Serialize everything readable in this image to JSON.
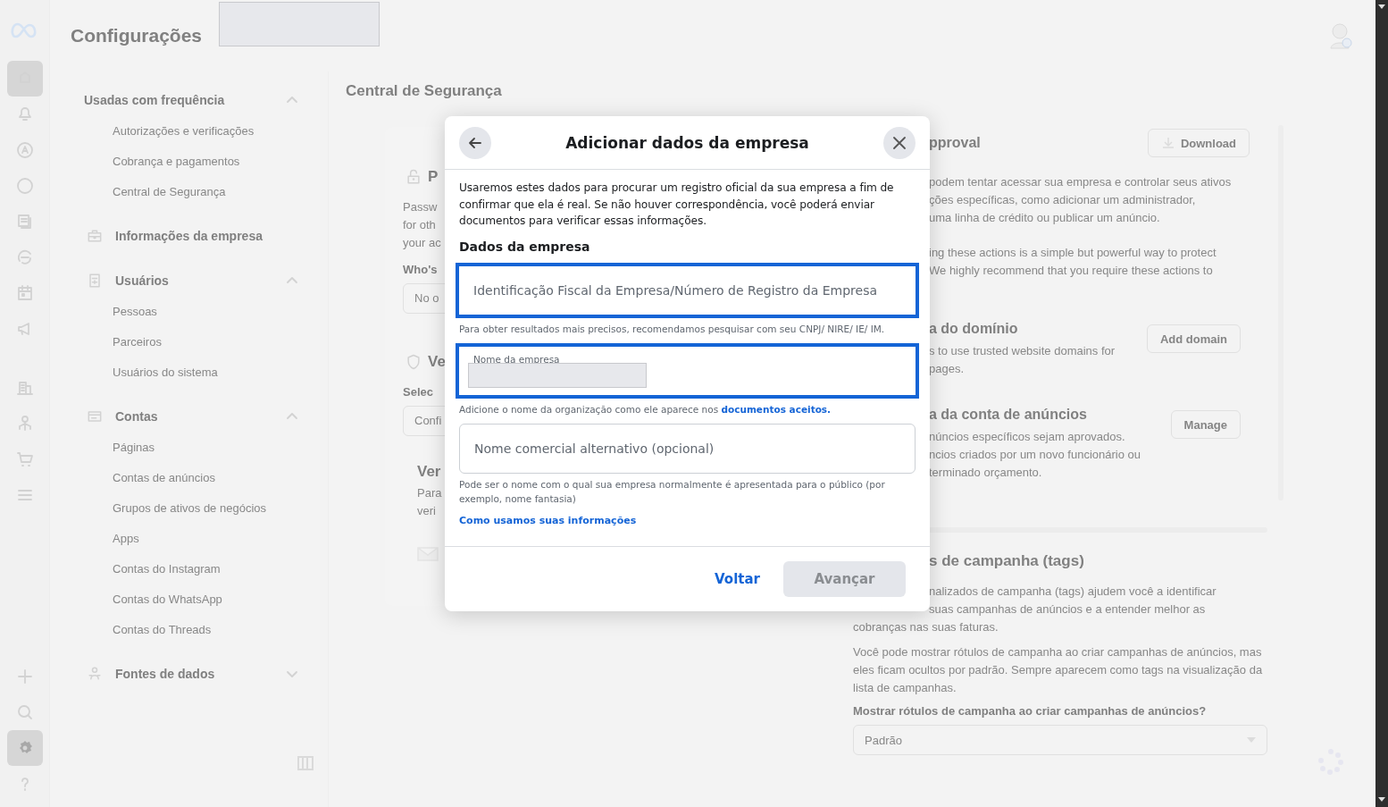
{
  "header": {
    "title": "Configurações"
  },
  "rail": [
    {
      "selected": true
    },
    {
      "selected": false
    },
    {
      "selected": false
    },
    {
      "selected": false
    },
    {
      "selected": false
    },
    {
      "selected": false
    },
    {
      "selected": false
    },
    {
      "selected": false
    },
    {
      "selected": false
    },
    {
      "selected": false
    },
    {
      "selected": false
    },
    {
      "selected": false
    }
  ],
  "rail_bottom": [
    {
      "selected": false
    },
    {
      "selected": false
    },
    {
      "selected": true
    },
    {
      "selected": false
    }
  ],
  "sidebar": {
    "groups": [
      {
        "title": "Usadas com frequência",
        "kind": "plain",
        "expanded": true,
        "items": [
          {
            "label": "Autorizações e verificações"
          },
          {
            "label": "Cobrança e pagamentos"
          },
          {
            "label": "Central de Segurança"
          }
        ]
      },
      {
        "title": "Informações da empresa",
        "kind": "link"
      },
      {
        "title": "Usuários",
        "kind": "icon",
        "expanded": true,
        "items": [
          {
            "label": "Pessoas"
          },
          {
            "label": "Parceiros"
          },
          {
            "label": "Usuários do sistema"
          }
        ]
      },
      {
        "title": "Contas",
        "kind": "icon",
        "expanded": true,
        "items": [
          {
            "label": "Páginas"
          },
          {
            "label": "Contas de anúncios"
          },
          {
            "label": "Grupos de ativos de negócios"
          },
          {
            "label": "Apps"
          },
          {
            "label": "Contas do Instagram"
          },
          {
            "label": "Contas do WhatsApp"
          },
          {
            "label": "Contas do Threads"
          }
        ]
      },
      {
        "title": "Fontes de dados",
        "kind": "icon",
        "expanded": false
      }
    ]
  },
  "main": {
    "heading": "Central de Segurança",
    "security_panel": {
      "section_1": {
        "title": "P",
        "lines": [
          "Passw",
          "for oth",
          "your ac"
        ],
        "question": "Who's",
        "field_value": "No o"
      },
      "section_2": {
        "title": "Ve",
        "question": "Selec",
        "field_value": "Confi"
      },
      "section_3": {
        "title": "Ver",
        "lines": [
          "Para",
          "veri"
        ]
      }
    },
    "settings_card": {
      "sections": [
        {
          "kind": "top",
          "title": "pproval",
          "button": "Download",
          "paragraphs": [
            [
              "podem tentar acessar sua empresa e controlar seus ativos",
              "ções específicas, como adicionar um administrador,",
              "uma linha de crédito ou publicar um anúncio."
            ],
            [
              "ing these actions is a simple but powerful way to protect",
              "We highly recommend that you require these actions to"
            ]
          ]
        },
        {
          "kind": "side",
          "title": "a do domínio",
          "button": "Add domain",
          "paragraphs": [
            [
              "s to use trusted website domains for",
              "pages."
            ]
          ]
        },
        {
          "kind": "side",
          "title": "a da conta de anúncios",
          "button": "Manage",
          "paragraphs": [
            [
              "núncios específicos sejam aprovados.",
              "ncios criados por um novo funcionário ou",
              "terminado orçamento."
            ]
          ]
        }
      ]
    },
    "tags_card": {
      "title": "s de campanha (tags)",
      "cut_lines": [
        "nalizados de campanha (tags) ajudem você a identificar",
        "suas campanhas de anúncios e a entender melhor as"
      ],
      "line": "cobranças nas suas faturas.",
      "paragraph": "Você pode mostrar rótulos de campanha ao criar campanhas de anúncios, mas eles ficam ocultos por padrão. Sempre aparecem como tags na visualização da lista de campanhas.",
      "question": "Mostrar rótulos de campanha ao criar campanhas de anúncios?",
      "select_value": "Padrão"
    }
  },
  "dialog": {
    "title": "Adicionar dados da empresa",
    "description": "Usaremos estes dados para procurar um registro oficial da sua empresa a fim de confirmar que ela é real. Se não houver correspondência, você poderá enviar documentos para verificar essas informações.",
    "section_heading": "Dados da empresa",
    "fields": [
      {
        "placeholder": "Identificação Fiscal da Empresa/Número de Registro da Empresa",
        "focused": true,
        "hint": "Para obter resultados mais precisos, recomendamos pesquisar com seu CNPJ/ NIRE/ IE/ IM."
      },
      {
        "label": "Nome da empresa",
        "focused": true,
        "hint": "Adicione o nome da organização como ele aparece nos",
        "hint_link": "documentos aceitos."
      },
      {
        "placeholder": "Nome comercial alternativo (opcional)",
        "focused": false,
        "hint": "Pode ser o nome com o qual sua empresa normalmente é apresentada para o público (por exemplo, nome fantasia)"
      }
    ],
    "info_link": "Como usamos suas informações",
    "buttons": [
      {
        "label": "Voltar",
        "kind": "link",
        "disabled": false
      },
      {
        "label": "Avançar",
        "kind": "primary",
        "disabled": true
      }
    ]
  }
}
